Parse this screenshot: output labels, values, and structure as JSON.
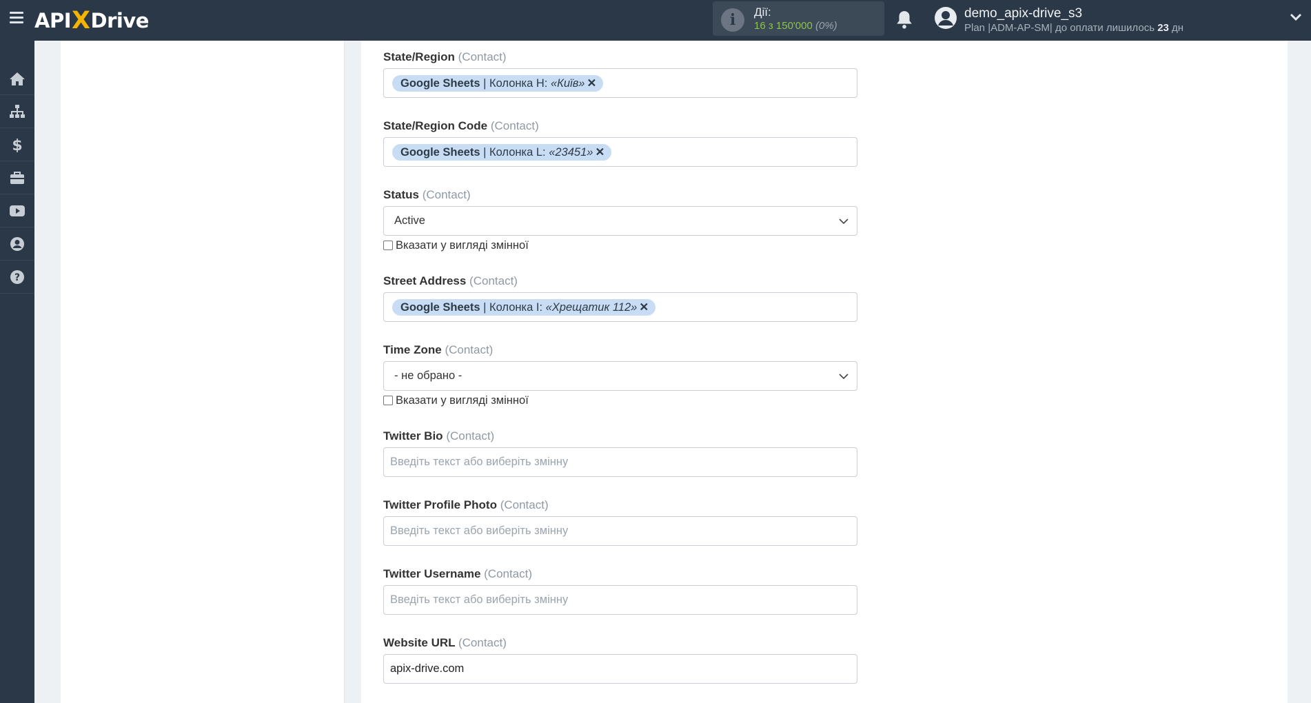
{
  "header": {
    "logo": {
      "left": "API",
      "x": "X",
      "right": "Drive"
    },
    "actions": {
      "label": "Дії:",
      "count": "16 з 150'000",
      "percent": "(0%)"
    },
    "user": {
      "name": "demo_apix-drive_s3",
      "plan_prefix": "Plan |ADM-AP-SM| до оплати лишилось ",
      "days": "23",
      "days_suffix": " дн"
    }
  },
  "sidebar": {
    "items": [
      {
        "icon": "home-icon"
      },
      {
        "icon": "sitemap-icon"
      },
      {
        "icon": "dollar-icon"
      },
      {
        "icon": "briefcase-icon"
      },
      {
        "icon": "youtube-icon"
      },
      {
        "icon": "user-circle-icon"
      },
      {
        "icon": "help-circle-icon"
      }
    ]
  },
  "form": {
    "context": "(Contact)",
    "checkbox_label": "Вказати у вигляді змінної",
    "placeholder": "Введіть текст або виберіть змінну",
    "fields": {
      "state_region": {
        "label": "State/Region",
        "tag_app": "Google Sheets",
        "tag_col": " | Колонка H: ",
        "tag_val": "«Київ»",
        "tag_x": "✕"
      },
      "state_region_code": {
        "label": "State/Region Code",
        "tag_app": "Google Sheets",
        "tag_col": " | Колонка L: ",
        "tag_val": "«23451»",
        "tag_x": "✕"
      },
      "status": {
        "label": "Status",
        "value": "Active"
      },
      "street_address": {
        "label": "Street Address",
        "tag_app": "Google Sheets",
        "tag_col": " | Колонка I: ",
        "tag_val": "«Хрещатик 112»",
        "tag_x": "✕"
      },
      "time_zone": {
        "label": "Time Zone",
        "value": "- не обрано -"
      },
      "twitter_bio": {
        "label": "Twitter Bio"
      },
      "twitter_profile_photo": {
        "label": "Twitter Profile Photo"
      },
      "twitter_username": {
        "label": "Twitter Username"
      },
      "website_url": {
        "label": "Website URL",
        "value": "apix-drive.com"
      }
    }
  },
  "colors": {
    "topbar": "#2b3847",
    "tag_bg": "#c8dcf3",
    "accent_yellow": "#f4b400",
    "count_green": "#8bc34a"
  }
}
